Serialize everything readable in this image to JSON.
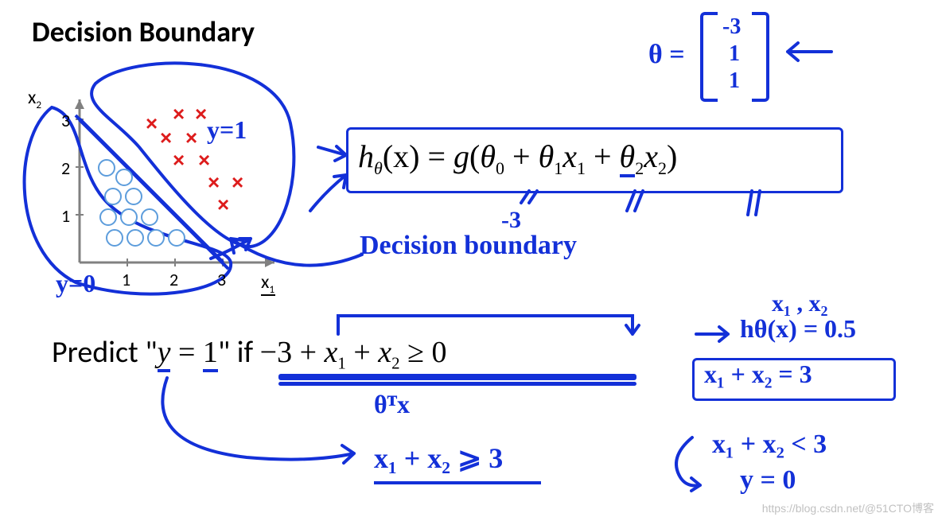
{
  "title": "Decision Boundary",
  "axes": {
    "x_label": "x",
    "x_sub": "1",
    "y_label": "x",
    "y_sub": "2",
    "ticks_x": [
      "1",
      "2",
      "3"
    ],
    "ticks_y": [
      "1",
      "2",
      "3"
    ]
  },
  "hypothesis": {
    "lhs_var": "h",
    "lhs_theta": "θ",
    "lhs_arg": "(x)",
    "eq": " = ",
    "g": "g",
    "open": "(",
    "t0": "θ",
    "t0s": "0",
    "t1": "θ",
    "t1s": "1",
    "x1": "x",
    "x1s": "1",
    "t2": "θ",
    "t2s": "2",
    "x2": "x",
    "x2s": "2",
    "plus": " + ",
    "close": ")"
  },
  "theta_vec": {
    "label": "θ =",
    "v0": "-3",
    "v1": "1",
    "v2": "1"
  },
  "predict": {
    "prefix": "Predict \"",
    "y": "y",
    "eq": " = ",
    "one": "1",
    "suffix": "\" if ",
    "expr_minus3": "−3 + ",
    "x1": "x",
    "x1s": "1",
    "plus": " + ",
    "x2": "x",
    "x2s": "2",
    "ge": " ≥ 0"
  },
  "annotations": {
    "y_eq_1": "y=1",
    "y_eq_0": "y=0",
    "minus3": "-3",
    "decision_boundary": "Decision boundary",
    "theta_t_x": "θᵀx",
    "x1x2_ge_3": "x₁ + x₂ ⩾ 3",
    "x1_x2_label": "x₁ , x₂",
    "h_half": "hθ(x) = 0.5",
    "x1x2_eq_3": "x₁ + x₂ = 3",
    "x1x2_lt_3": "x₁ + x₂ < 3",
    "y_eq_0b": "y = 0"
  },
  "chart_data": {
    "type": "scatter",
    "title": "",
    "xlabel": "x1",
    "ylabel": "x2",
    "xlim": [
      0,
      3.5
    ],
    "ylim": [
      0,
      3.5
    ],
    "series": [
      {
        "name": "y=0 (circles)",
        "marker": "o",
        "values": [
          [
            0.5,
            2.0
          ],
          [
            0.9,
            1.8
          ],
          [
            0.7,
            1.4
          ],
          [
            1.1,
            1.4
          ],
          [
            0.6,
            1.0
          ],
          [
            1.0,
            1.0
          ],
          [
            1.4,
            1.0
          ],
          [
            0.7,
            0.6
          ],
          [
            1.1,
            0.6
          ],
          [
            1.5,
            0.6
          ],
          [
            1.9,
            0.6
          ]
        ]
      },
      {
        "name": "y=1 (crosses)",
        "marker": "x",
        "values": [
          [
            1.7,
            2.9
          ],
          [
            2.2,
            3.0
          ],
          [
            2.6,
            3.0
          ],
          [
            1.9,
            2.5
          ],
          [
            2.4,
            2.5
          ],
          [
            2.2,
            2.1
          ],
          [
            2.6,
            2.1
          ],
          [
            2.8,
            1.7
          ],
          [
            3.2,
            1.7
          ],
          [
            2.9,
            1.3
          ]
        ]
      }
    ],
    "boundary_line": {
      "equation": "x1 + x2 = 3",
      "points": [
        [
          0,
          3
        ],
        [
          3,
          0
        ]
      ]
    }
  },
  "watermark": "https://blog.csdn.net/@51CTO博客"
}
